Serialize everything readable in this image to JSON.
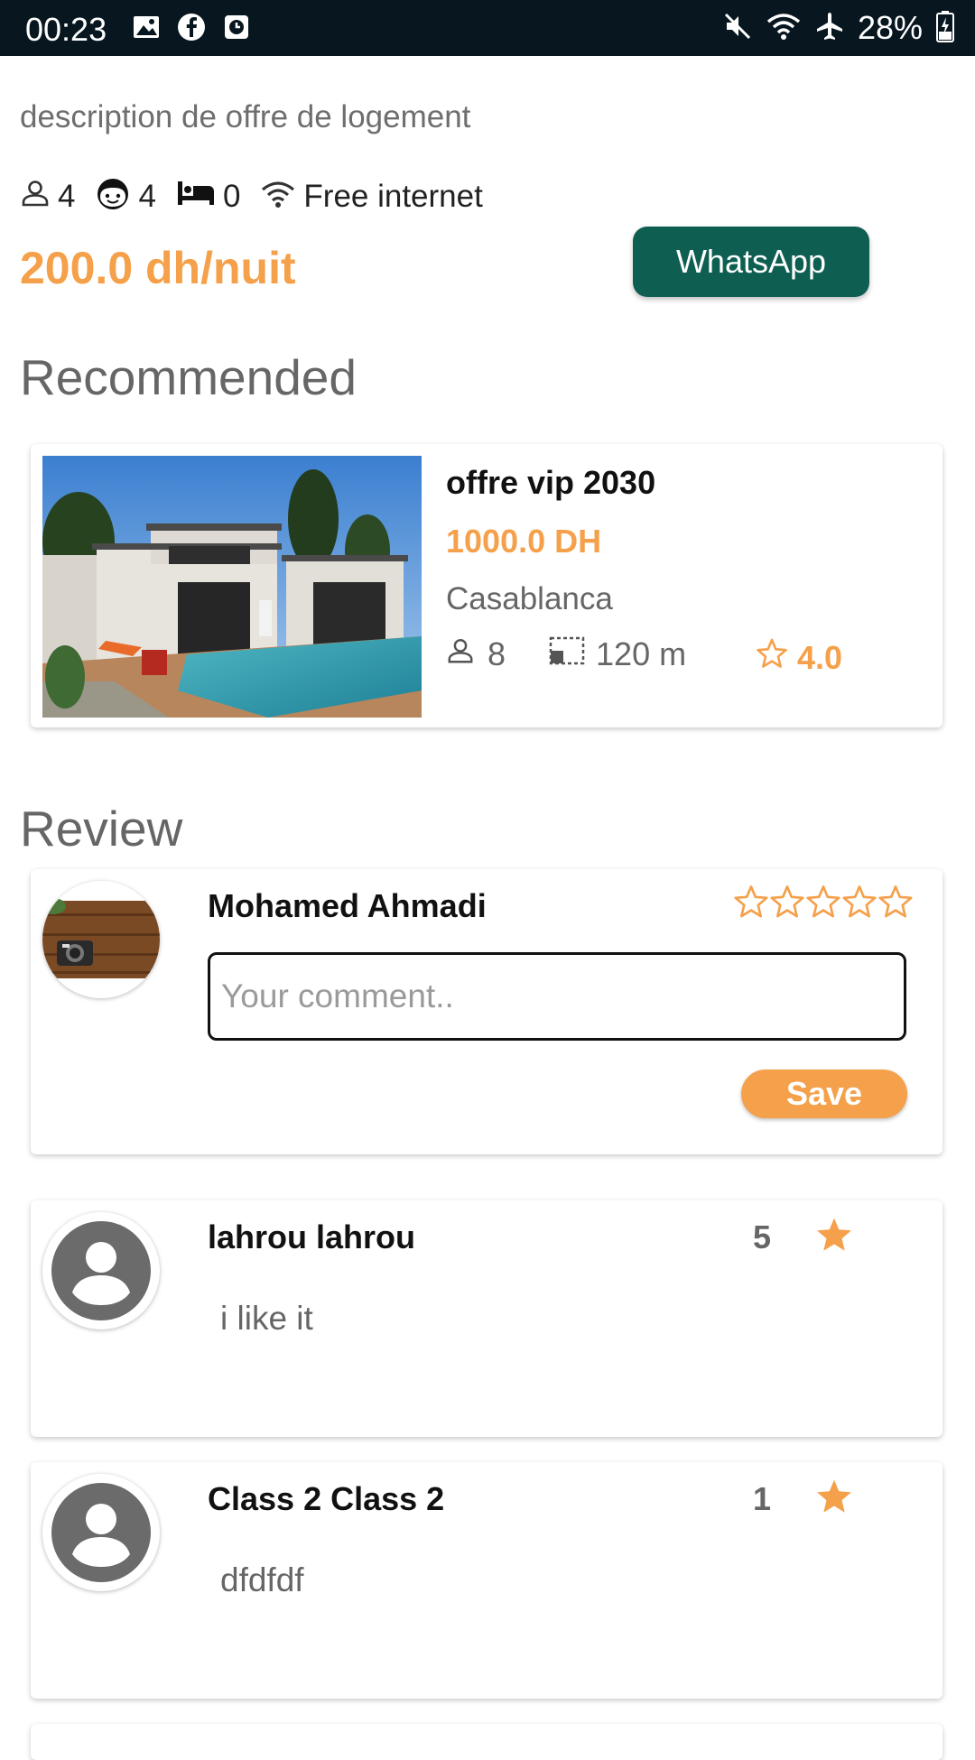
{
  "status_bar": {
    "time": "00:23",
    "battery": "28%"
  },
  "listing": {
    "description": "description de  offre de logement",
    "adults": "4",
    "children": "4",
    "beds": "0",
    "internet": "Free internet",
    "price": "200.0 dh/nuit",
    "whatsapp_label": "WhatsApp"
  },
  "recommended": {
    "section_title": "Recommended",
    "items": [
      {
        "title": "offre vip 2030",
        "price": "1000.0 DH",
        "city": "Casablanca",
        "guests": "8",
        "area": "120 m",
        "rating": "4.0"
      }
    ]
  },
  "review": {
    "section_title": "Review",
    "composer": {
      "user_name": "Mohamed Ahmadi",
      "placeholder": "Your comment..",
      "value": "",
      "rating": 0,
      "save_label": "Save"
    },
    "items": [
      {
        "name": "lahrou lahrou",
        "score": "5",
        "text": "i like it"
      },
      {
        "name": "Class 2 Class 2",
        "score": "1",
        "text": "dfdfdf"
      }
    ]
  },
  "colors": {
    "accent": "#f5a04a",
    "whatsapp": "#0f5e52",
    "status_bar": "#07161f"
  }
}
